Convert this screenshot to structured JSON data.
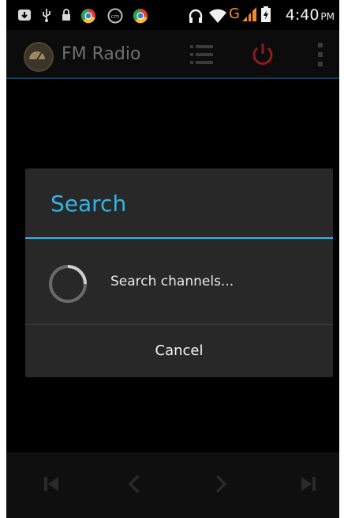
{
  "statusbar": {
    "time": "4:40",
    "ampm": "PM",
    "network_type": "G",
    "icons": [
      "download-icon",
      "usb-icon",
      "lock-icon",
      "chrome-icon",
      "cm-icon",
      "chrome-icon",
      "headphones-icon",
      "wifi-icon",
      "signal-icon",
      "battery-icon"
    ]
  },
  "actionbar": {
    "title": "FM Radio",
    "icons": [
      "radio-app-icon",
      "channel-list-icon",
      "power-icon",
      "overflow-menu-icon"
    ]
  },
  "dialog": {
    "title": "Search",
    "message": "Search channels...",
    "cancel_label": "Cancel",
    "accent_color": "#33b5e5"
  },
  "controls": {
    "icons": [
      "skip-previous-icon",
      "seek-back-icon",
      "seek-forward-icon",
      "skip-next-icon"
    ]
  },
  "colors": {
    "accent": "#33b5e5",
    "power_icon": "#8b1e1a",
    "network_type": "#f08a2a"
  }
}
